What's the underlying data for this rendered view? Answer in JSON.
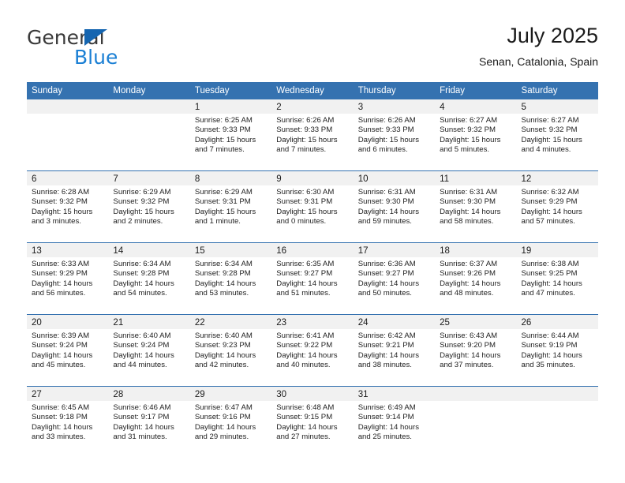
{
  "brand": {
    "name_top": "General",
    "name_bottom": "Blue",
    "accent_color": "#1a7fd4",
    "triangle_color": "#1565b0"
  },
  "header": {
    "title": "July 2025",
    "subtitle": "Senan, Catalonia, Spain"
  },
  "calendar": {
    "header_color": "#3572b0",
    "day_band_color": "#f1f1f1",
    "weekday_headers": [
      "Sunday",
      "Monday",
      "Tuesday",
      "Wednesday",
      "Thursday",
      "Friday",
      "Saturday"
    ],
    "weeks": [
      [
        {
          "day": "",
          "sunrise": "",
          "sunset": "",
          "daylight_line1": "",
          "daylight_line2": ""
        },
        {
          "day": "",
          "sunrise": "",
          "sunset": "",
          "daylight_line1": "",
          "daylight_line2": ""
        },
        {
          "day": "1",
          "sunrise": "Sunrise: 6:25 AM",
          "sunset": "Sunset: 9:33 PM",
          "daylight_line1": "Daylight: 15 hours",
          "daylight_line2": "and 7 minutes."
        },
        {
          "day": "2",
          "sunrise": "Sunrise: 6:26 AM",
          "sunset": "Sunset: 9:33 PM",
          "daylight_line1": "Daylight: 15 hours",
          "daylight_line2": "and 7 minutes."
        },
        {
          "day": "3",
          "sunrise": "Sunrise: 6:26 AM",
          "sunset": "Sunset: 9:33 PM",
          "daylight_line1": "Daylight: 15 hours",
          "daylight_line2": "and 6 minutes."
        },
        {
          "day": "4",
          "sunrise": "Sunrise: 6:27 AM",
          "sunset": "Sunset: 9:32 PM",
          "daylight_line1": "Daylight: 15 hours",
          "daylight_line2": "and 5 minutes."
        },
        {
          "day": "5",
          "sunrise": "Sunrise: 6:27 AM",
          "sunset": "Sunset: 9:32 PM",
          "daylight_line1": "Daylight: 15 hours",
          "daylight_line2": "and 4 minutes."
        }
      ],
      [
        {
          "day": "6",
          "sunrise": "Sunrise: 6:28 AM",
          "sunset": "Sunset: 9:32 PM",
          "daylight_line1": "Daylight: 15 hours",
          "daylight_line2": "and 3 minutes."
        },
        {
          "day": "7",
          "sunrise": "Sunrise: 6:29 AM",
          "sunset": "Sunset: 9:32 PM",
          "daylight_line1": "Daylight: 15 hours",
          "daylight_line2": "and 2 minutes."
        },
        {
          "day": "8",
          "sunrise": "Sunrise: 6:29 AM",
          "sunset": "Sunset: 9:31 PM",
          "daylight_line1": "Daylight: 15 hours",
          "daylight_line2": "and 1 minute."
        },
        {
          "day": "9",
          "sunrise": "Sunrise: 6:30 AM",
          "sunset": "Sunset: 9:31 PM",
          "daylight_line1": "Daylight: 15 hours",
          "daylight_line2": "and 0 minutes."
        },
        {
          "day": "10",
          "sunrise": "Sunrise: 6:31 AM",
          "sunset": "Sunset: 9:30 PM",
          "daylight_line1": "Daylight: 14 hours",
          "daylight_line2": "and 59 minutes."
        },
        {
          "day": "11",
          "sunrise": "Sunrise: 6:31 AM",
          "sunset": "Sunset: 9:30 PM",
          "daylight_line1": "Daylight: 14 hours",
          "daylight_line2": "and 58 minutes."
        },
        {
          "day": "12",
          "sunrise": "Sunrise: 6:32 AM",
          "sunset": "Sunset: 9:29 PM",
          "daylight_line1": "Daylight: 14 hours",
          "daylight_line2": "and 57 minutes."
        }
      ],
      [
        {
          "day": "13",
          "sunrise": "Sunrise: 6:33 AM",
          "sunset": "Sunset: 9:29 PM",
          "daylight_line1": "Daylight: 14 hours",
          "daylight_line2": "and 56 minutes."
        },
        {
          "day": "14",
          "sunrise": "Sunrise: 6:34 AM",
          "sunset": "Sunset: 9:28 PM",
          "daylight_line1": "Daylight: 14 hours",
          "daylight_line2": "and 54 minutes."
        },
        {
          "day": "15",
          "sunrise": "Sunrise: 6:34 AM",
          "sunset": "Sunset: 9:28 PM",
          "daylight_line1": "Daylight: 14 hours",
          "daylight_line2": "and 53 minutes."
        },
        {
          "day": "16",
          "sunrise": "Sunrise: 6:35 AM",
          "sunset": "Sunset: 9:27 PM",
          "daylight_line1": "Daylight: 14 hours",
          "daylight_line2": "and 51 minutes."
        },
        {
          "day": "17",
          "sunrise": "Sunrise: 6:36 AM",
          "sunset": "Sunset: 9:27 PM",
          "daylight_line1": "Daylight: 14 hours",
          "daylight_line2": "and 50 minutes."
        },
        {
          "day": "18",
          "sunrise": "Sunrise: 6:37 AM",
          "sunset": "Sunset: 9:26 PM",
          "daylight_line1": "Daylight: 14 hours",
          "daylight_line2": "and 48 minutes."
        },
        {
          "day": "19",
          "sunrise": "Sunrise: 6:38 AM",
          "sunset": "Sunset: 9:25 PM",
          "daylight_line1": "Daylight: 14 hours",
          "daylight_line2": "and 47 minutes."
        }
      ],
      [
        {
          "day": "20",
          "sunrise": "Sunrise: 6:39 AM",
          "sunset": "Sunset: 9:24 PM",
          "daylight_line1": "Daylight: 14 hours",
          "daylight_line2": "and 45 minutes."
        },
        {
          "day": "21",
          "sunrise": "Sunrise: 6:40 AM",
          "sunset": "Sunset: 9:24 PM",
          "daylight_line1": "Daylight: 14 hours",
          "daylight_line2": "and 44 minutes."
        },
        {
          "day": "22",
          "sunrise": "Sunrise: 6:40 AM",
          "sunset": "Sunset: 9:23 PM",
          "daylight_line1": "Daylight: 14 hours",
          "daylight_line2": "and 42 minutes."
        },
        {
          "day": "23",
          "sunrise": "Sunrise: 6:41 AM",
          "sunset": "Sunset: 9:22 PM",
          "daylight_line1": "Daylight: 14 hours",
          "daylight_line2": "and 40 minutes."
        },
        {
          "day": "24",
          "sunrise": "Sunrise: 6:42 AM",
          "sunset": "Sunset: 9:21 PM",
          "daylight_line1": "Daylight: 14 hours",
          "daylight_line2": "and 38 minutes."
        },
        {
          "day": "25",
          "sunrise": "Sunrise: 6:43 AM",
          "sunset": "Sunset: 9:20 PM",
          "daylight_line1": "Daylight: 14 hours",
          "daylight_line2": "and 37 minutes."
        },
        {
          "day": "26",
          "sunrise": "Sunrise: 6:44 AM",
          "sunset": "Sunset: 9:19 PM",
          "daylight_line1": "Daylight: 14 hours",
          "daylight_line2": "and 35 minutes."
        }
      ],
      [
        {
          "day": "27",
          "sunrise": "Sunrise: 6:45 AM",
          "sunset": "Sunset: 9:18 PM",
          "daylight_line1": "Daylight: 14 hours",
          "daylight_line2": "and 33 minutes."
        },
        {
          "day": "28",
          "sunrise": "Sunrise: 6:46 AM",
          "sunset": "Sunset: 9:17 PM",
          "daylight_line1": "Daylight: 14 hours",
          "daylight_line2": "and 31 minutes."
        },
        {
          "day": "29",
          "sunrise": "Sunrise: 6:47 AM",
          "sunset": "Sunset: 9:16 PM",
          "daylight_line1": "Daylight: 14 hours",
          "daylight_line2": "and 29 minutes."
        },
        {
          "day": "30",
          "sunrise": "Sunrise: 6:48 AM",
          "sunset": "Sunset: 9:15 PM",
          "daylight_line1": "Daylight: 14 hours",
          "daylight_line2": "and 27 minutes."
        },
        {
          "day": "31",
          "sunrise": "Sunrise: 6:49 AM",
          "sunset": "Sunset: 9:14 PM",
          "daylight_line1": "Daylight: 14 hours",
          "daylight_line2": "and 25 minutes."
        },
        {
          "day": "",
          "sunrise": "",
          "sunset": "",
          "daylight_line1": "",
          "daylight_line2": ""
        },
        {
          "day": "",
          "sunrise": "",
          "sunset": "",
          "daylight_line1": "",
          "daylight_line2": ""
        }
      ]
    ]
  }
}
